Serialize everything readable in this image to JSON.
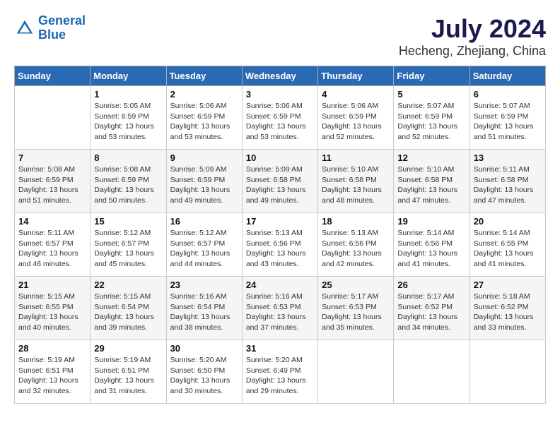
{
  "header": {
    "logo_line1": "General",
    "logo_line2": "Blue",
    "month_year": "July 2024",
    "location": "Hecheng, Zhejiang, China"
  },
  "weekdays": [
    "Sunday",
    "Monday",
    "Tuesday",
    "Wednesday",
    "Thursday",
    "Friday",
    "Saturday"
  ],
  "weeks": [
    [
      {
        "day": "",
        "info": ""
      },
      {
        "day": "1",
        "info": "Sunrise: 5:05 AM\nSunset: 6:59 PM\nDaylight: 13 hours\nand 53 minutes."
      },
      {
        "day": "2",
        "info": "Sunrise: 5:06 AM\nSunset: 6:59 PM\nDaylight: 13 hours\nand 53 minutes."
      },
      {
        "day": "3",
        "info": "Sunrise: 5:06 AM\nSunset: 6:59 PM\nDaylight: 13 hours\nand 53 minutes."
      },
      {
        "day": "4",
        "info": "Sunrise: 5:06 AM\nSunset: 6:59 PM\nDaylight: 13 hours\nand 52 minutes."
      },
      {
        "day": "5",
        "info": "Sunrise: 5:07 AM\nSunset: 6:59 PM\nDaylight: 13 hours\nand 52 minutes."
      },
      {
        "day": "6",
        "info": "Sunrise: 5:07 AM\nSunset: 6:59 PM\nDaylight: 13 hours\nand 51 minutes."
      }
    ],
    [
      {
        "day": "7",
        "info": ""
      },
      {
        "day": "8",
        "info": "Sunrise: 5:08 AM\nSunset: 6:59 PM\nDaylight: 13 hours\nand 50 minutes."
      },
      {
        "day": "9",
        "info": "Sunrise: 5:09 AM\nSunset: 6:59 PM\nDaylight: 13 hours\nand 49 minutes."
      },
      {
        "day": "10",
        "info": "Sunrise: 5:09 AM\nSunset: 6:58 PM\nDaylight: 13 hours\nand 49 minutes."
      },
      {
        "day": "11",
        "info": "Sunrise: 5:10 AM\nSunset: 6:58 PM\nDaylight: 13 hours\nand 48 minutes."
      },
      {
        "day": "12",
        "info": "Sunrise: 5:10 AM\nSunset: 6:58 PM\nDaylight: 13 hours\nand 47 minutes."
      },
      {
        "day": "13",
        "info": "Sunrise: 5:11 AM\nSunset: 6:58 PM\nDaylight: 13 hours\nand 47 minutes."
      }
    ],
    [
      {
        "day": "14",
        "info": ""
      },
      {
        "day": "15",
        "info": "Sunrise: 5:12 AM\nSunset: 6:57 PM\nDaylight: 13 hours\nand 45 minutes."
      },
      {
        "day": "16",
        "info": "Sunrise: 5:12 AM\nSunset: 6:57 PM\nDaylight: 13 hours\nand 44 minutes."
      },
      {
        "day": "17",
        "info": "Sunrise: 5:13 AM\nSunset: 6:56 PM\nDaylight: 13 hours\nand 43 minutes."
      },
      {
        "day": "18",
        "info": "Sunrise: 5:13 AM\nSunset: 6:56 PM\nDaylight: 13 hours\nand 42 minutes."
      },
      {
        "day": "19",
        "info": "Sunrise: 5:14 AM\nSunset: 6:56 PM\nDaylight: 13 hours\nand 41 minutes."
      },
      {
        "day": "20",
        "info": "Sunrise: 5:14 AM\nSunset: 6:55 PM\nDaylight: 13 hours\nand 41 minutes."
      }
    ],
    [
      {
        "day": "21",
        "info": ""
      },
      {
        "day": "22",
        "info": "Sunrise: 5:15 AM\nSunset: 6:54 PM\nDaylight: 13 hours\nand 39 minutes."
      },
      {
        "day": "23",
        "info": "Sunrise: 5:16 AM\nSunset: 6:54 PM\nDaylight: 13 hours\nand 38 minutes."
      },
      {
        "day": "24",
        "info": "Sunrise: 5:16 AM\nSunset: 6:53 PM\nDaylight: 13 hours\nand 37 minutes."
      },
      {
        "day": "25",
        "info": "Sunrise: 5:17 AM\nSunset: 6:53 PM\nDaylight: 13 hours\nand 35 minutes."
      },
      {
        "day": "26",
        "info": "Sunrise: 5:17 AM\nSunset: 6:52 PM\nDaylight: 13 hours\nand 34 minutes."
      },
      {
        "day": "27",
        "info": "Sunrise: 5:18 AM\nSunset: 6:52 PM\nDaylight: 13 hours\nand 33 minutes."
      }
    ],
    [
      {
        "day": "28",
        "info": "Sunrise: 5:19 AM\nSunset: 6:51 PM\nDaylight: 13 hours\nand 32 minutes."
      },
      {
        "day": "29",
        "info": "Sunrise: 5:19 AM\nSunset: 6:51 PM\nDaylight: 13 hours\nand 31 minutes."
      },
      {
        "day": "30",
        "info": "Sunrise: 5:20 AM\nSunset: 6:50 PM\nDaylight: 13 hours\nand 30 minutes."
      },
      {
        "day": "31",
        "info": "Sunrise: 5:20 AM\nSunset: 6:49 PM\nDaylight: 13 hours\nand 29 minutes."
      },
      {
        "day": "",
        "info": ""
      },
      {
        "day": "",
        "info": ""
      },
      {
        "day": "",
        "info": ""
      }
    ]
  ],
  "week1_sun_info": "Sunrise: 5:08 AM\nSunset: 6:59 PM\nDaylight: 13 hours\nand 51 minutes.",
  "week3_sun_info": "Sunrise: 5:11 AM\nSunset: 6:57 PM\nDaylight: 13 hours\nand 46 minutes.",
  "week4_sun_info": "Sunrise: 5:15 AM\nSunset: 6:55 PM\nDaylight: 13 hours\nand 40 minutes."
}
